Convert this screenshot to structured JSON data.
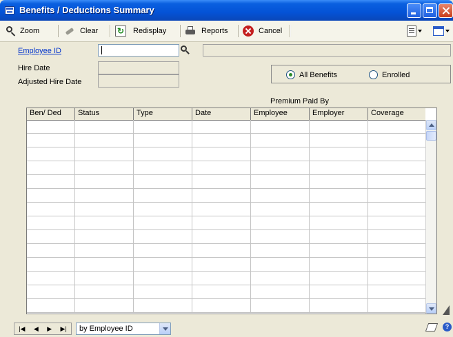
{
  "window": {
    "title": "Benefits / Deductions Summary"
  },
  "toolbar": {
    "zoom_label": "Zoom",
    "clear_label": "Clear",
    "redisplay_label": "Redisplay",
    "reports_label": "Reports",
    "cancel_label": "Cancel"
  },
  "form": {
    "employee_id_label": "Employee ID",
    "employee_id_value": "",
    "employee_name_value": "",
    "hire_date_label": "Hire Date",
    "hire_date_value": "",
    "adjusted_hire_date_label": "Adjusted Hire Date",
    "adjusted_hire_date_value": ""
  },
  "filter": {
    "options": [
      {
        "label": "All Benefits",
        "selected": true
      },
      {
        "label": "Enrolled",
        "selected": false
      }
    ]
  },
  "table": {
    "group_header": "Premium Paid By",
    "columns": [
      "Ben/ Ded",
      "Status",
      "Type",
      "Date",
      "Employee",
      "Employer",
      "Coverage"
    ],
    "rows": []
  },
  "bottom": {
    "sort_by_value": "by Employee ID",
    "nav": [
      "first",
      "previous",
      "next",
      "last"
    ]
  }
}
